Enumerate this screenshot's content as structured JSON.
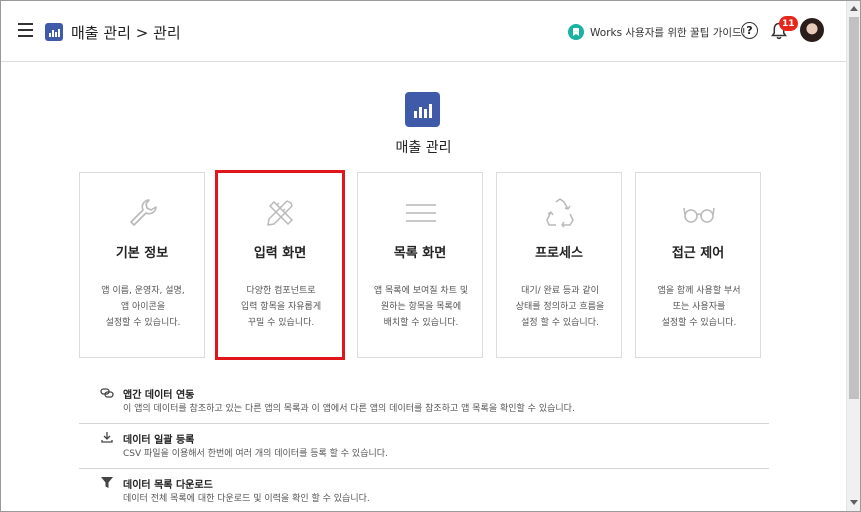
{
  "header": {
    "breadcrumb": "매출 관리 > 관리",
    "guide_label": "Works 사용자를 위한 꿀팁 가이드!",
    "help_symbol": "?",
    "notification_count": "11",
    "icons": [
      "menu-icon",
      "app-logo-icon",
      "bookmark-icon",
      "help-icon",
      "bell-icon",
      "avatar"
    ]
  },
  "hero": {
    "title": "매출 관리",
    "logo_icon": "bar-chart-icon",
    "logo_color": "#3f5aa8"
  },
  "cards": [
    {
      "title": "기본 정보",
      "icon": "wrench-icon",
      "desc": [
        "앱 이름, 운영자, 설명,",
        "앱 아이콘을",
        "설정할 수 있습니다."
      ]
    },
    {
      "title": "입력 화면",
      "icon": "pencil-ruler-icon",
      "desc": [
        "다양한 컴포넌트로",
        "입력 항목을 자유롭게",
        "꾸밀 수 있습니다."
      ],
      "selected": true
    },
    {
      "title": "목록 화면",
      "icon": "list-lines-icon",
      "desc": [
        "앱 목록에 보여질 차트 및",
        "원하는 항목을 목록에",
        "배치할 수 있습니다."
      ]
    },
    {
      "title": "프로세스",
      "icon": "recycle-icon",
      "desc": [
        "대기/ 완료 등과 같이",
        "상태를 정의하고 흐름을",
        "설정 할 수 있습니다."
      ]
    },
    {
      "title": "접근 제어",
      "icon": "glasses-icon",
      "desc": [
        "앱을 함께 사용할 부서",
        "또는 사용자를",
        "설정할 수 있습니다."
      ]
    }
  ],
  "links": [
    {
      "title": "앱간 데이터 연동",
      "icon": "link-icon",
      "desc": "이 앱의 데이터를 참조하고 있는 다른 앱의 목록과 이 앱에서 다른 앱의 데이터를 참조하고 앱 목록을 확인할 수 있습니다."
    },
    {
      "title": "데이터 일괄 등록",
      "icon": "upload-icon",
      "desc": "CSV 파일을 이용해서 한번에 여러 개의 데이터를 등록 할 수 있습니다."
    },
    {
      "title": "데이터 목록 다운로드",
      "icon": "filter-icon",
      "desc": "데이터 전체 목록에 대한 다운로드 및 이력을 확인 할 수 있습니다."
    }
  ],
  "colors": {
    "selection_outline": "#e0161b",
    "notification_badge": "#e8271c",
    "guide_icon": "#1ab2a0"
  }
}
